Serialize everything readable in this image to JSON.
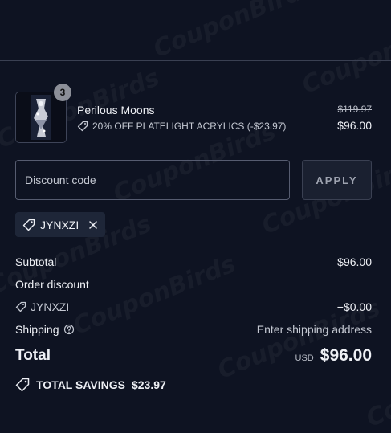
{
  "watermark": "CouponBirds",
  "line_item": {
    "name": "Perilous Moons",
    "quantity": "3",
    "discount_text": "20% OFF PLATELIGHT ACRYLICS (-$23.97)",
    "original_price": "$119.97",
    "price": "$96.00"
  },
  "discount_form": {
    "placeholder": "Discount code",
    "apply_label": "APPLY"
  },
  "applied_code": "JYNXZI",
  "summary": {
    "subtotal_label": "Subtotal",
    "subtotal_value": "$96.00",
    "order_discount_label": "Order discount",
    "discount_code": "JYNXZI",
    "discount_value": "−$0.00",
    "shipping_label": "Shipping",
    "shipping_value": "Enter shipping address",
    "total_label": "Total",
    "currency": "USD",
    "total_value": "$96.00",
    "savings_label": "TOTAL SAVINGS",
    "savings_value": "$23.97"
  },
  "colors": {
    "background": "#0e1322",
    "border": "#565c70",
    "chip": "#1e2638",
    "text": "#eef0f5"
  }
}
